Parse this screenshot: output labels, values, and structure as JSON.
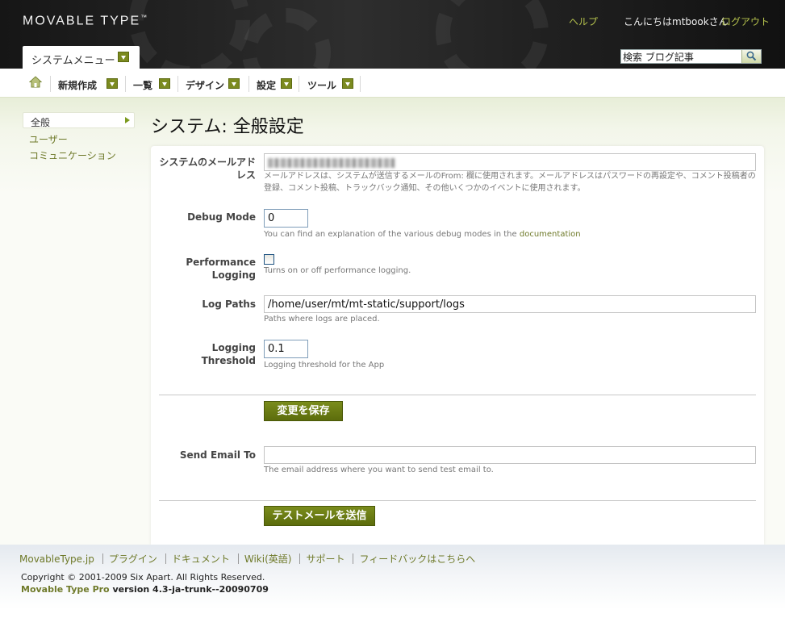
{
  "header": {
    "logo": "MOVABLE TYPE",
    "logo_tm": "™",
    "help": "ヘルプ",
    "greeting": "こんにちはmtbookさん",
    "logout": "ログアウト",
    "system_menu": "システムメニュー",
    "search_value": "検索 ブログ記事"
  },
  "nav": {
    "items": [
      {
        "label": "新規作成"
      },
      {
        "label": "一覧"
      },
      {
        "label": "デザイン"
      },
      {
        "label": "設定"
      },
      {
        "label": "ツール"
      }
    ]
  },
  "sidebar": {
    "items": [
      {
        "label": "全般",
        "active": true
      },
      {
        "label": "ユーザー"
      },
      {
        "label": "コミュニケーション"
      }
    ]
  },
  "page": {
    "title": "システム: 全般設定"
  },
  "form": {
    "email_label": "システムのメールアドレス",
    "email_hint": "メールアドレスは、システムが送信するメールのFrom: 欄に使用されます。メールアドレスはパスワードの再設定や、コメント投稿者の登録、コメント投稿、トラックバック通知、その他いくつかのイベントに使用されます。",
    "debug_label": "Debug Mode",
    "debug_value": "0",
    "debug_hint": "You can find an explanation of the various debug modes in the",
    "debug_hint_link": "documentation",
    "perf_label_1": "Performance",
    "perf_label_2": "Logging",
    "perf_checked": false,
    "perf_hint": "Turns on or off performance logging.",
    "logpaths_label": "Log Paths",
    "logpaths_value": "/home/user/mt/mt-static/support/logs",
    "logpaths_hint": "Paths where logs are placed.",
    "threshold_label": "Logging Threshold",
    "threshold_value": "0.1",
    "threshold_hint": "Logging threshold for the App",
    "save_button": "変更を保存",
    "sendemail_label": "Send Email To",
    "sendemail_value": "",
    "sendemail_hint": "The email address where you want to send test email to.",
    "test_button": "テストメールを送信"
  },
  "footer": {
    "links": [
      "MovableType.jp",
      "プラグイン",
      "ドキュメント",
      "Wiki(英語)",
      "サポート",
      "フィードバックはこちらへ"
    ],
    "copyright": "Copyright © 2001-2009 Six Apart. All Rights Reserved.",
    "product": "Movable Type Pro",
    "version": "version 4.3-ja-trunk--20090709"
  },
  "colors": {
    "accent": "#6f7a2a",
    "button": "#6a7a14",
    "header_bg": "#222222"
  }
}
